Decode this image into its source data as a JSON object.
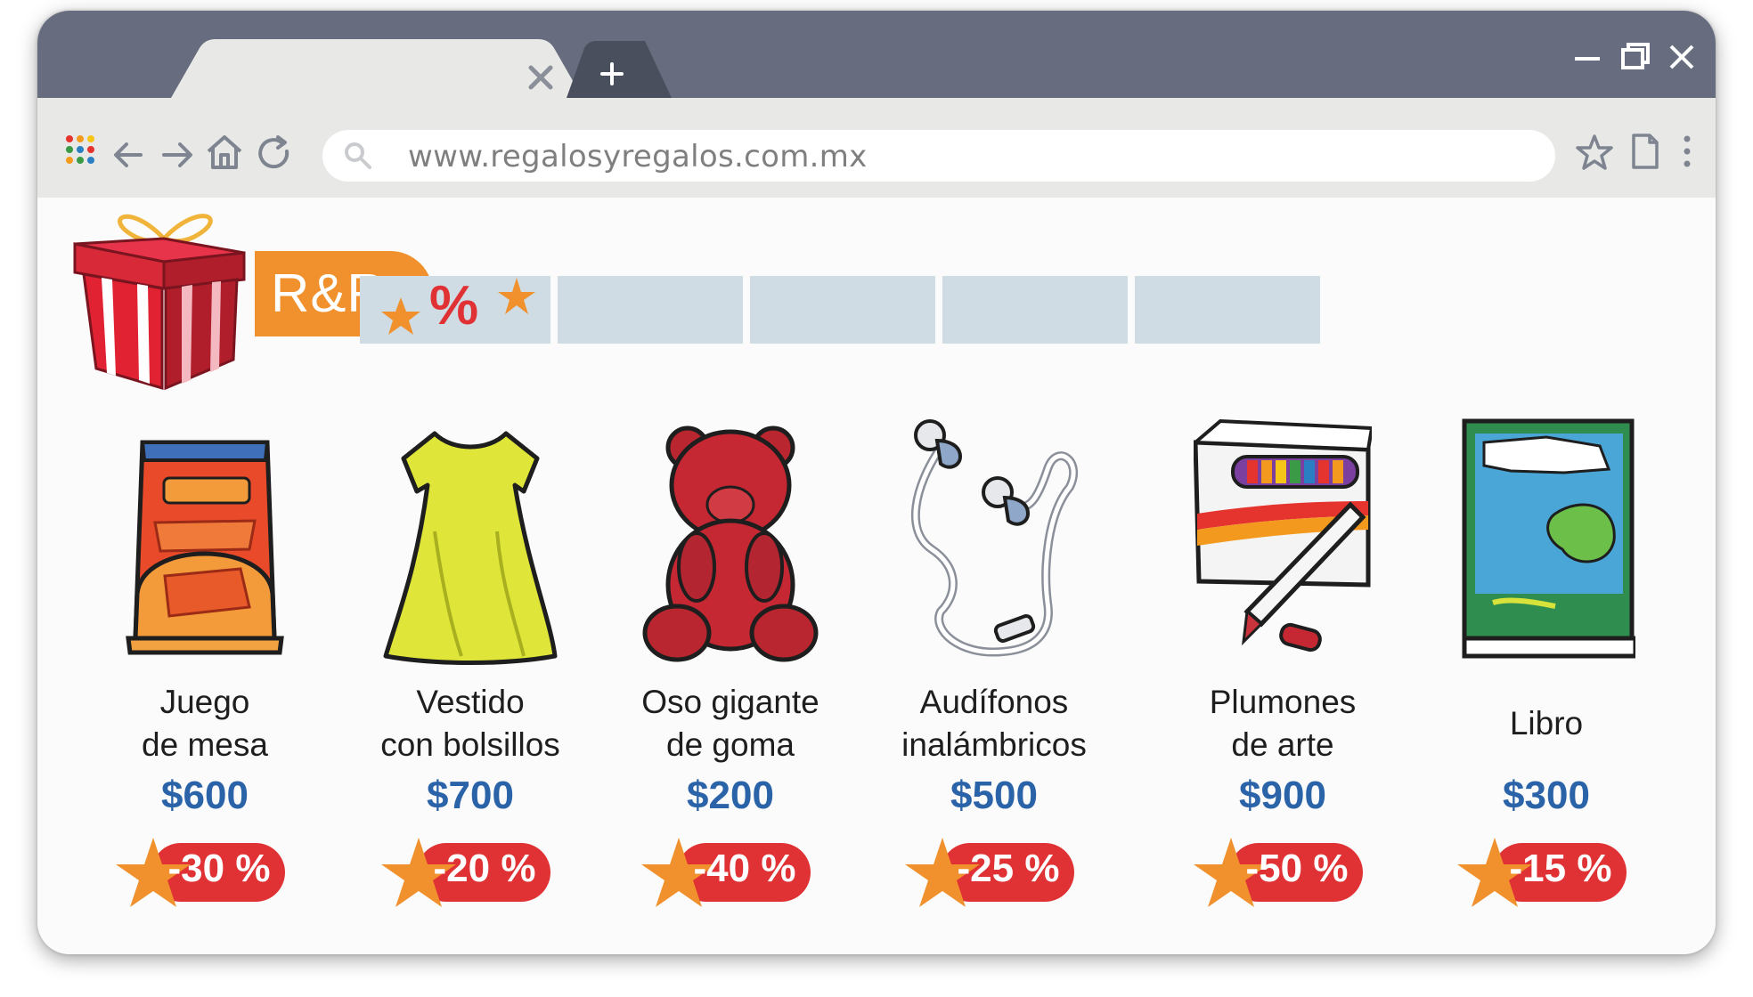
{
  "browser": {
    "url": "www.regalosyregalos.com.mx",
    "colors": {
      "frame": "#676d7e",
      "toolbar": "#e8e9e7",
      "active_tab": "#e8e9e7"
    }
  },
  "site": {
    "logo": "R&R",
    "colors": {
      "logo_bg": "#f0912d",
      "nav_bg": "#cfdce3",
      "price": "#2b63a8",
      "badge": "#e03234",
      "star": "#f0912d"
    },
    "nav": [
      {
        "label": "%",
        "icon": "percent-stars-icon"
      },
      {
        "label": ""
      },
      {
        "label": ""
      },
      {
        "label": ""
      },
      {
        "label": ""
      }
    ]
  },
  "products": [
    {
      "name": "Juego\nde mesa",
      "price": "$600",
      "discount": "-30 %",
      "icon": "board-game-icon"
    },
    {
      "name": "Vestido\ncon bolsillos",
      "price": "$700",
      "discount": "-20 %",
      "icon": "dress-icon"
    },
    {
      "name": "Oso gigante\nde goma",
      "price": "$200",
      "discount": "-40 %",
      "icon": "gummy-bear-icon"
    },
    {
      "name": "Audífonos\ninalámbricos",
      "price": "$500",
      "discount": "-25 %",
      "icon": "earphones-icon"
    },
    {
      "name": "Plumones\nde arte",
      "price": "$900",
      "discount": "-50 %",
      "icon": "markers-icon"
    },
    {
      "name": "Libro",
      "price": "$300",
      "discount": "-15 %",
      "icon": "book-icon"
    }
  ]
}
